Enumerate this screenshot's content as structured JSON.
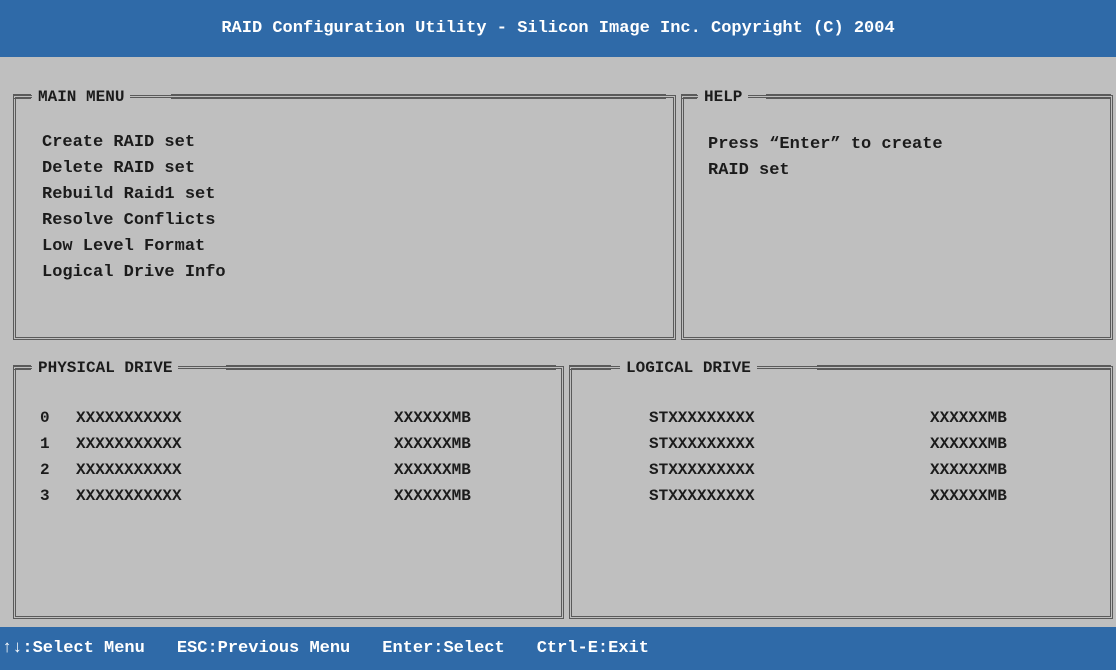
{
  "title": "RAID Configuration Utility - Silicon Image Inc. Copyright (C) 2004",
  "main_menu": {
    "heading": "MAIN MENU",
    "items": [
      {
        "label": "Create RAID set"
      },
      {
        "label": "Delete RAID set"
      },
      {
        "label": "Rebuild Raid1 set"
      },
      {
        "label": "Resolve Conflicts"
      },
      {
        "label": "Low Level Format"
      },
      {
        "label": "Logical Drive Info"
      }
    ]
  },
  "help": {
    "heading": "HELP",
    "lines": [
      "Press “Enter” to create",
      "RAID set"
    ]
  },
  "physical_drive": {
    "heading": "PHYSICAL DRIVE",
    "rows": [
      {
        "index": "0",
        "model": "XXXXXXXXXXX",
        "size": "XXXXXXMB"
      },
      {
        "index": "1",
        "model": "XXXXXXXXXXX",
        "size": "XXXXXXMB"
      },
      {
        "index": "2",
        "model": "XXXXXXXXXXX",
        "size": "XXXXXXMB"
      },
      {
        "index": "3",
        "model": "XXXXXXXXXXX",
        "size": "XXXXXXMB"
      }
    ]
  },
  "logical_drive": {
    "heading": "LOGICAL DRIVE",
    "rows": [
      {
        "name": "STXXXXXXXXX",
        "size": "XXXXXXMB"
      },
      {
        "name": "STXXXXXXXXX",
        "size": "XXXXXXMB"
      },
      {
        "name": "STXXXXXXXXX",
        "size": "XXXXXXMB"
      },
      {
        "name": "STXXXXXXXXX",
        "size": "XXXXXXMB"
      }
    ]
  },
  "footer": {
    "items": [
      {
        "key": "↑↓",
        "text": ":Select Menu"
      },
      {
        "key": "ESC",
        "text": ":Previous Menu"
      },
      {
        "key": "Enter",
        "text": ":Select"
      },
      {
        "key": "Ctrl-E",
        "text": ":Exit"
      }
    ]
  },
  "colors": {
    "title_bar": "#2f6aa8",
    "background": "#bfbfbf",
    "text": "#1b1b1b",
    "border": "#5a5a5a"
  }
}
